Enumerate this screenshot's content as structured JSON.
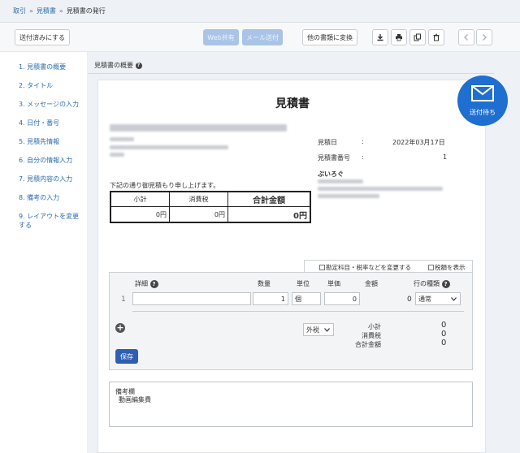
{
  "breadcrumb": {
    "item1": "取引",
    "item2": "見積書",
    "current": "見積書の発行",
    "sep": "»"
  },
  "toolbar": {
    "mark_sent": "送付済みにする",
    "web_send": "Web共有",
    "mail_send": "メール送付",
    "convert": "他の書類に変換"
  },
  "sidebar": {
    "items": [
      "1. 見積書の概要",
      "2. タイトル",
      "3. メッセージの入力",
      "4. 日付・番号",
      "5. 見積先情報",
      "6. 自分の情報入力",
      "7. 見積内容の入力",
      "8. 備考の入力",
      "9. レイアウトを変更する"
    ]
  },
  "tab": {
    "label": "見積書の概要",
    "help": "?"
  },
  "document": {
    "title": "見積書",
    "message": "下記の通り御見積もり申し上げます。",
    "date_label": "見積日",
    "date_colon": ":",
    "date_value": "2022年03月17日",
    "number_label": "見積書番号",
    "number_colon": ":",
    "number_value": "1",
    "company": "ぶいろぐ"
  },
  "totals": {
    "subtotal_label": "小計",
    "tax_label": "消費税",
    "total_label": "合計金額",
    "subtotal_value": "0円",
    "tax_value": "0円",
    "total_value": "0円"
  },
  "options": {
    "change_accounts": "勘定科目・税率などを変更する",
    "show_tax": "税額を表示"
  },
  "lines": {
    "headers": {
      "detail": "詳細",
      "qty": "数量",
      "unit": "単位",
      "price": "単価",
      "amount": "金額",
      "row_type": "行の種類"
    },
    "row": {
      "index": "1",
      "detail": "",
      "qty": "1",
      "unit": "個",
      "price": "0",
      "amount": "0",
      "row_type": "通常"
    },
    "tax_mode": "外税",
    "summary": {
      "subtotal_label": "小計",
      "tax_label": "消費税",
      "total_label": "合計金額",
      "subtotal": "0",
      "tax": "0",
      "total": "0"
    },
    "save": "保存",
    "add": "+"
  },
  "remarks": {
    "label": "備考欄",
    "text": "動画編集費"
  },
  "badge": {
    "label": "送付待ち"
  },
  "colors": {
    "accent": "#2f5fb3",
    "badge": "#1f6fd0",
    "link": "#2b6cb0",
    "background": "#eef1f5"
  }
}
